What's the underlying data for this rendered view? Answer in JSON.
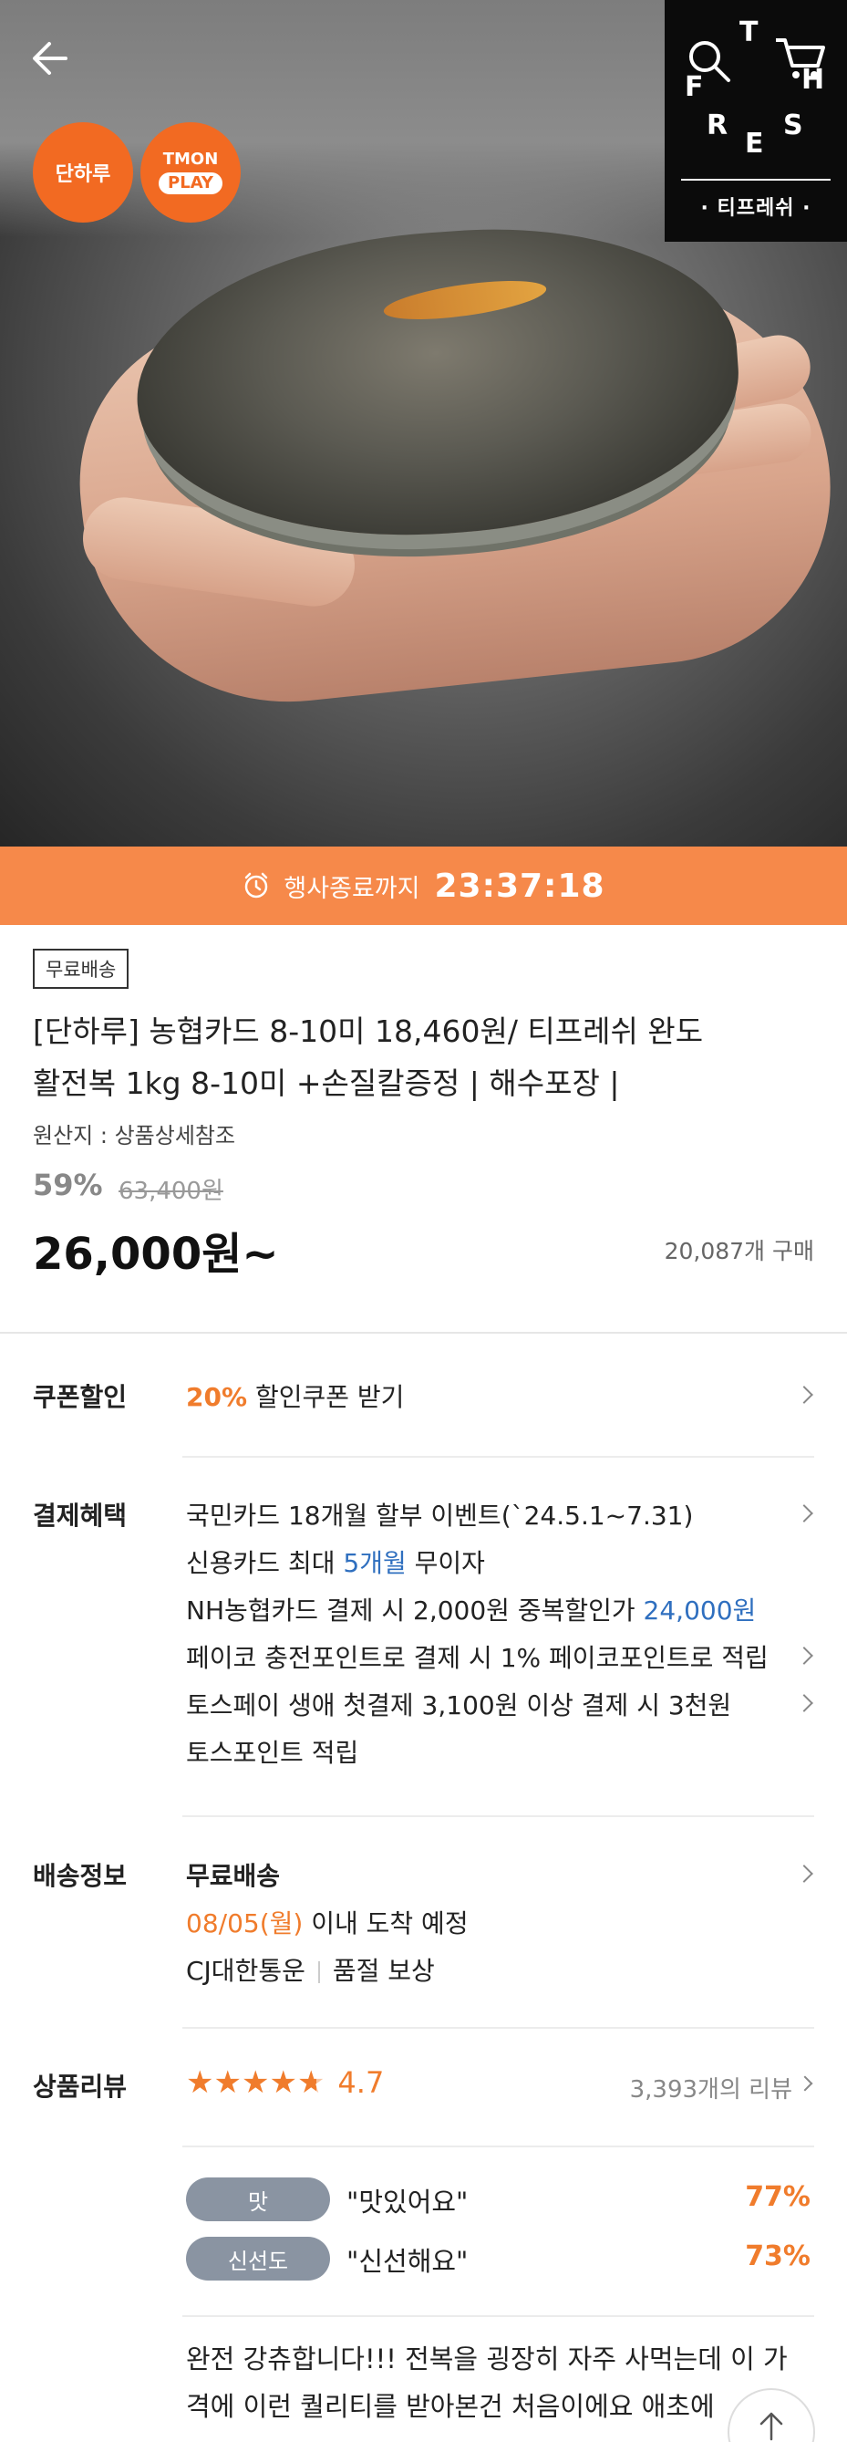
{
  "hero": {
    "badge_danharu": "단하루",
    "badge_tmon_top": "TMON",
    "badge_tmon_bottom": "PLAY",
    "brand_letters": [
      "T",
      "H",
      "F",
      "R",
      "E",
      "S"
    ],
    "brand_sub": "· 티프레쉬 ·"
  },
  "timer": {
    "label": "행사종료까지",
    "time": "23:37:18"
  },
  "product": {
    "free_shipping_tag": "무료배송",
    "title_line1": "[단하루] 농협카드 8-10미 18,460원/ 티프레쉬 완도",
    "title_line2": "활전복 1kg 8-10미 +손질칼증정 | 해수포장 |",
    "origin": "원산지 : 상품상세참조",
    "discount": "59%",
    "original_price": "63,400원",
    "price": "26,000원~",
    "buy_count": "20,087개 구매"
  },
  "coupon": {
    "label": "쿠폰할인",
    "percent": "20%",
    "text": "할인쿠폰 받기"
  },
  "payment": {
    "label": "결제혜택",
    "line1": "국민카드 18개월 할부 이벤트(`24.5.1~7.31)",
    "line2_pre": "신용카드 최대 ",
    "line2_highlight": "5개월",
    "line2_post": " 무이자",
    "line3_pre": "NH농협카드 결제 시 2,000원 중복할인가 ",
    "line3_highlight": "24,000원",
    "line4": "페이코 충전포인트로 결제 시 1% 페이코포인트로 적립",
    "line5": "토스페이 생애 첫결제 3,100원 이상 결제 시 3천원",
    "line6": "토스포인트 적립"
  },
  "shipping": {
    "label": "배송정보",
    "type": "무료배송",
    "date": "08/05(월)",
    "date_suffix": " 이내 도착 예정",
    "carrier": "CJ대한통운",
    "guarantee": "품절 보상"
  },
  "review": {
    "label": "상품리뷰",
    "rating_value": 4.7,
    "rating": "4.7",
    "count": "3,393개의 리뷰",
    "tags": [
      {
        "tag": "맛",
        "quote": "\"맛있어요\"",
        "percent": "77%"
      },
      {
        "tag": "신선도",
        "quote": "\"신선해요\"",
        "percent": "73%"
      }
    ],
    "text_line1": "완전 강츄합니다!!! 전복을 굉장히 자주 사먹는데 이 가",
    "text_line2": "격에 이런 퀄리티를 받아본건 처음이에요 애초에"
  }
}
